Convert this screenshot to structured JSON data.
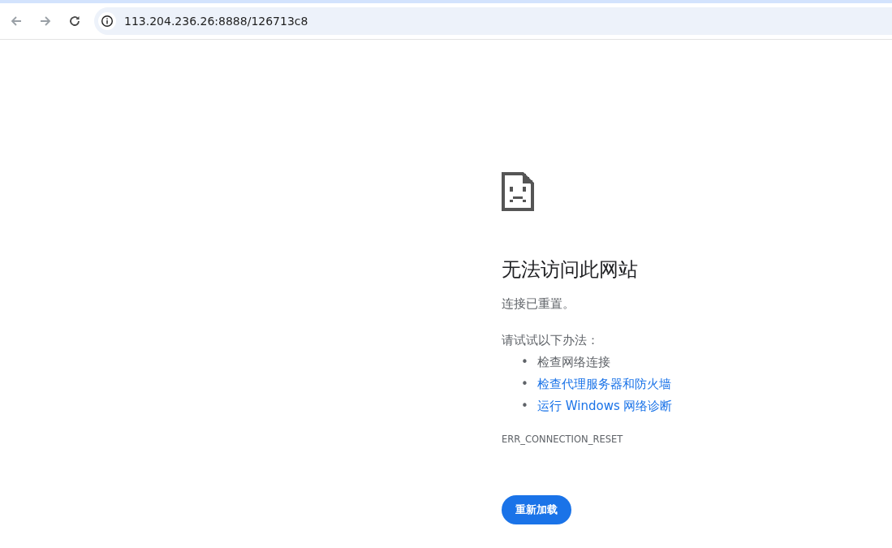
{
  "toolbar": {
    "back": {
      "disabled": true
    },
    "forward": {
      "disabled": true
    },
    "address": "113.204.236.26:8888/126713c8"
  },
  "error": {
    "title": "无法访问此网站",
    "message": "连接已重置。",
    "suggestions_heading": "请试试以下办法：",
    "suggestions": [
      {
        "kind": "text",
        "bullet": "•",
        "text": "检查网络连接"
      },
      {
        "kind": "link",
        "bullet": "•",
        "text": "检查代理服务器和防火墙"
      },
      {
        "kind": "link",
        "bullet": "•",
        "text": "运行 Windows 网络诊断"
      }
    ],
    "code": "ERR_CONNECTION_RESET",
    "reload_button": "重新加载"
  }
}
